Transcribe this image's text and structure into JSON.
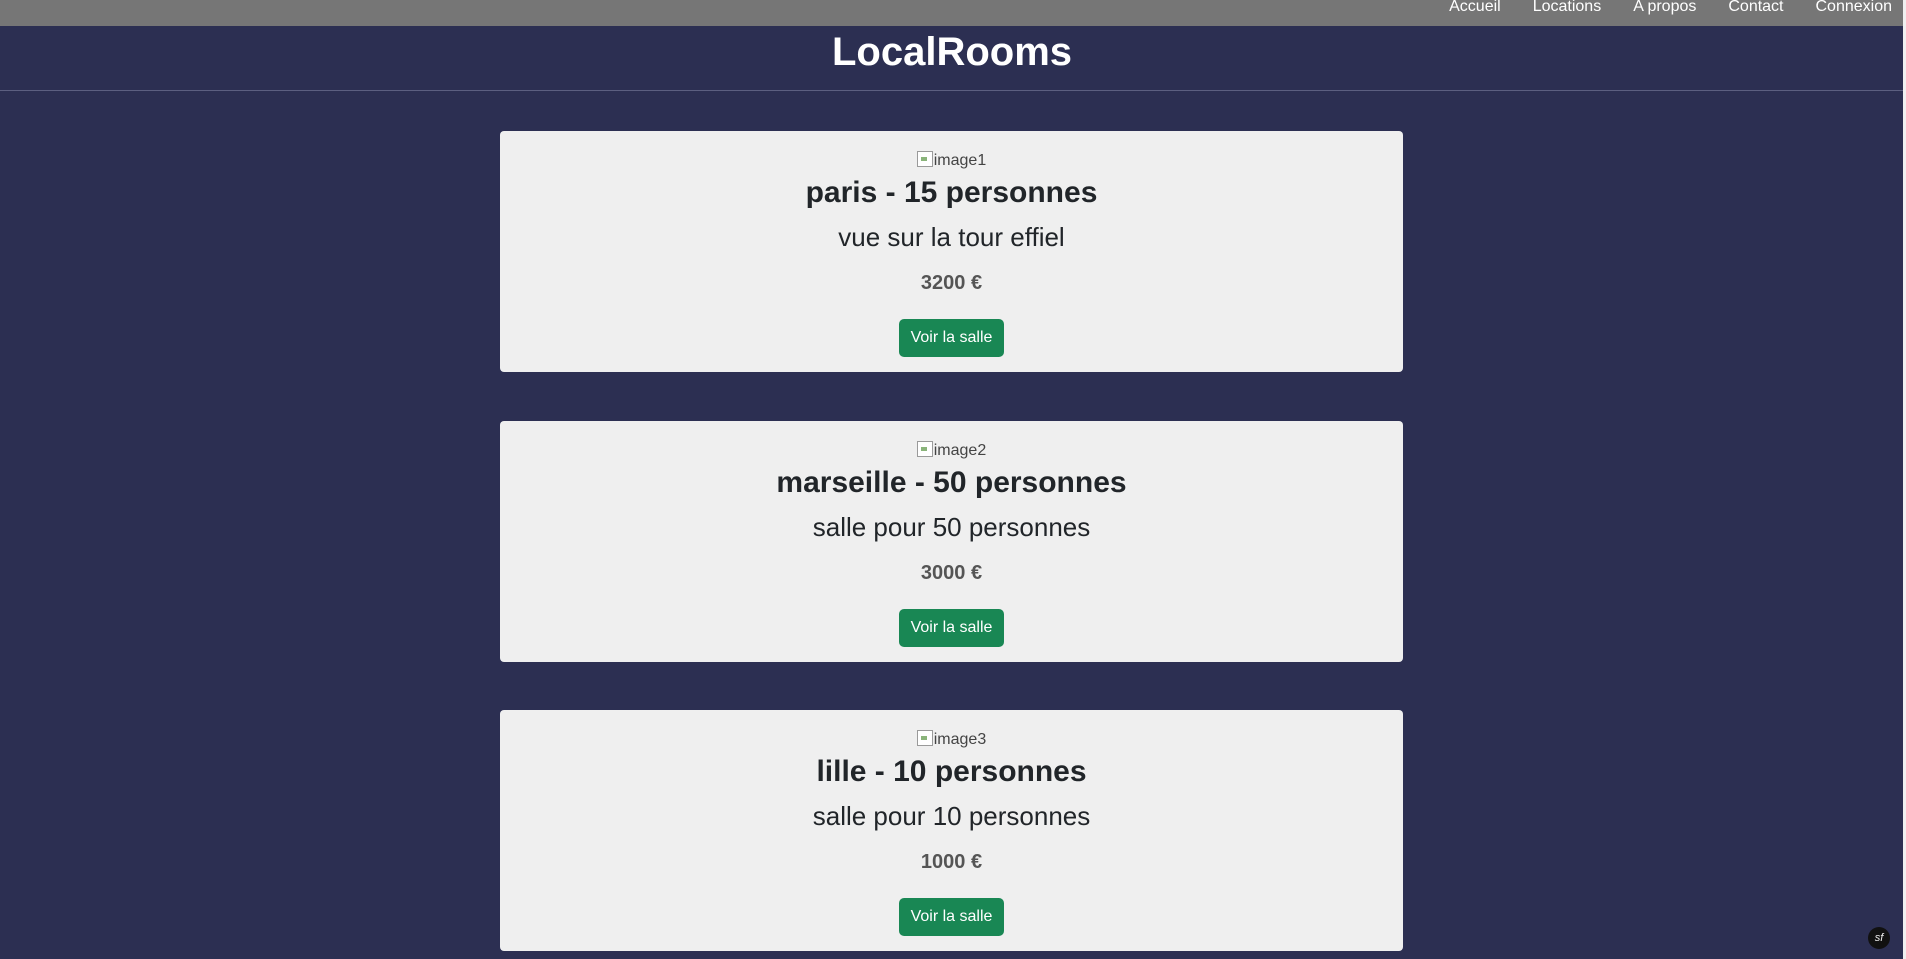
{
  "nav": {
    "items": [
      {
        "label": "Accueil"
      },
      {
        "label": "Locations"
      },
      {
        "label": "A propos"
      },
      {
        "label": "Contact"
      },
      {
        "label": "Connexion"
      }
    ]
  },
  "header": {
    "title": "LocalRooms"
  },
  "rooms": [
    {
      "image_alt": "image1",
      "title": "paris - 15 personnes",
      "description": "vue sur la tour effiel",
      "price": "3200 €",
      "button_label": "Voir la salle"
    },
    {
      "image_alt": "image2",
      "title": "marseille - 50 personnes",
      "description": "salle pour 50 personnes",
      "price": "3000 €",
      "button_label": "Voir la salle"
    },
    {
      "image_alt": "image3",
      "title": "lille - 10 personnes",
      "description": "salle pour 10 personnes",
      "price": "1000 €",
      "button_label": "Voir la salle"
    }
  ],
  "colors": {
    "page_background": "#2c2f52",
    "nav_background": "#767676",
    "card_background": "#efefef",
    "button_background": "#198754"
  },
  "footer": {
    "debug_badge": "sf"
  }
}
